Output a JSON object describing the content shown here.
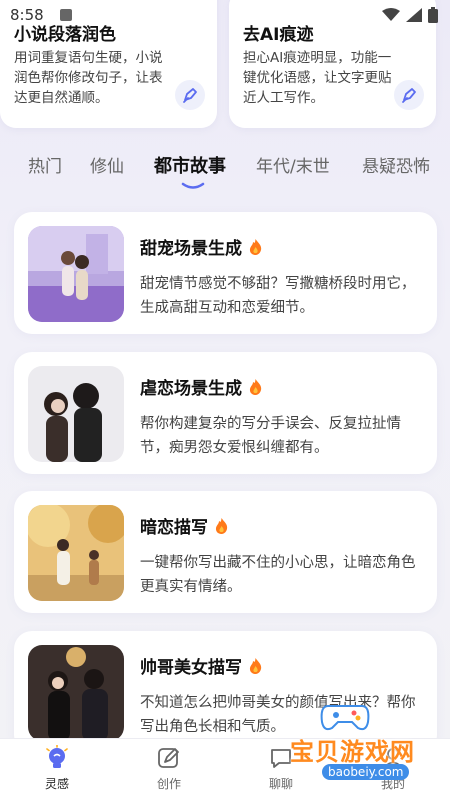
{
  "status": {
    "time": "8:58"
  },
  "tools": [
    {
      "title": "小说段落润色",
      "desc": "用词重复语句生硬，小说润色帮你修改句子，让表达更自然通顺。"
    },
    {
      "title": "去AI痕迹",
      "desc": "担心AI痕迹明显，功能一键优化语感，让文字更贴近人工写作。"
    }
  ],
  "tabs": [
    "热门",
    "修仙",
    "都市故事",
    "年代/末世",
    "悬疑恐怖"
  ],
  "active_tab": "都市故事",
  "cards": [
    {
      "title": "甜宠场景生成",
      "desc": "甜宠情节感觉不够甜？写撒糖桥段时用它，生成高甜互动和恋爱细节。"
    },
    {
      "title": "虐恋场景生成",
      "desc": "帮你构建复杂的写分手误会、反复拉扯情节，痴男怨女爱恨纠缠都有。"
    },
    {
      "title": "暗恋描写",
      "desc": "一键帮你写出藏不住的小心思，让暗恋角色更真实有情绪。"
    },
    {
      "title": "帅哥美女描写",
      "desc": "不知道怎么把帅哥美女的颜值写出来？帮你写出角色长相和气质。"
    }
  ],
  "nav": [
    {
      "label": "灵感",
      "icon": "lightbulb-icon"
    },
    {
      "label": "创作",
      "icon": "compass-pen-icon"
    },
    {
      "label": "聊聊",
      "icon": "chat-icon"
    },
    {
      "label": "我的",
      "icon": "profile-icon"
    }
  ],
  "watermark": {
    "text": "宝贝游戏网",
    "url": "baobeiy.com"
  },
  "colors": {
    "accent": "#5b6cf0",
    "fire": "#ff7a1a"
  }
}
